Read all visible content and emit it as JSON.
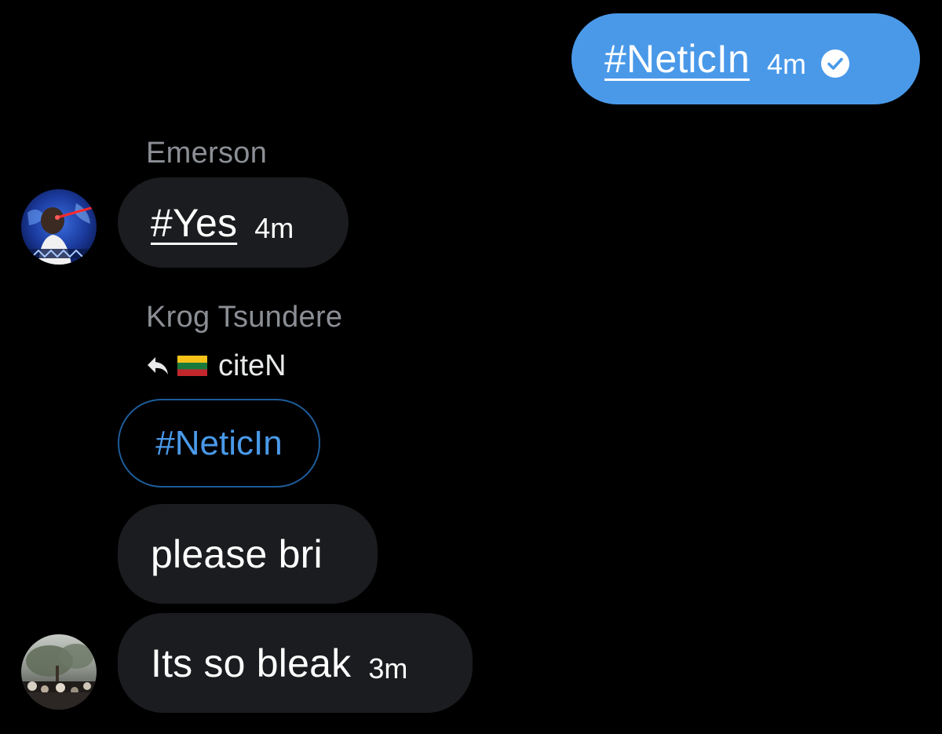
{
  "messages": {
    "sent": {
      "text": "#NeticIn",
      "time": "4m",
      "status_icon": "check-circle-icon"
    },
    "emerson": {
      "sender": "Emerson",
      "text": "#Yes",
      "time": "4m"
    },
    "krog": {
      "sender": "Krog Tsundere",
      "reply_to": {
        "icon": "reply-arrow-icon",
        "flag": "lithuania-flag-icon",
        "text": "citeN"
      },
      "quoted_text": "#NeticIn",
      "bubbles": [
        {
          "text": "please bri"
        },
        {
          "text": "Its so bleak",
          "time": "3m"
        }
      ]
    }
  },
  "colors": {
    "background": "#000000",
    "sent_bubble": "#4a99e9",
    "received_bubble": "#1b1c1f",
    "sender_name": "#8b8f95",
    "accent": "#4a99e9"
  }
}
